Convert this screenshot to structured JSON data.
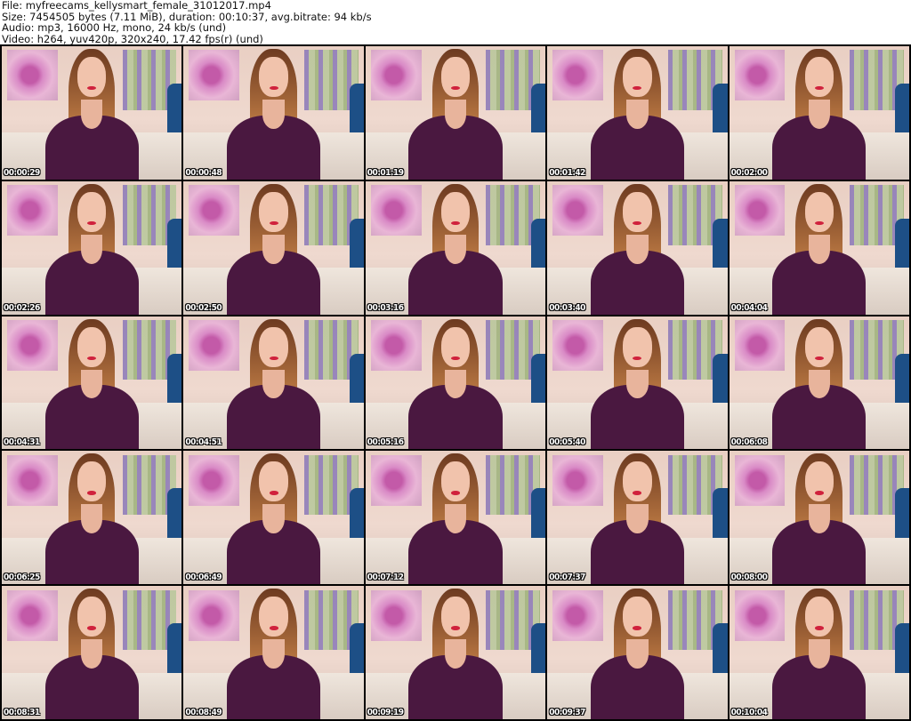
{
  "header": {
    "file": "File: myfreecams_kellysmart_female_31012017.mp4",
    "size": "Size: 7454505 bytes (7.11 MiB), duration: 00:10:37, avg.bitrate: 94 kb/s",
    "audio": "Audio: mp3, 16000 Hz, mono, 24 kb/s (und)",
    "video": "Video: h264, yuv420p, 320x240, 17.42 fps(r) (und)"
  },
  "thumbnails": [
    "00:00:29",
    "00:00:48",
    "00:01:19",
    "00:01:42",
    "00:02:00",
    "00:02:26",
    "00:02:50",
    "00:03:16",
    "00:03:40",
    "00:04:04",
    "00:04:31",
    "00:04:51",
    "00:05:16",
    "00:05:40",
    "00:06:08",
    "00:06:25",
    "00:06:49",
    "00:07:12",
    "00:07:37",
    "00:08:00",
    "00:08:31",
    "00:08:49",
    "00:09:19",
    "00:09:37",
    "00:10:04"
  ]
}
